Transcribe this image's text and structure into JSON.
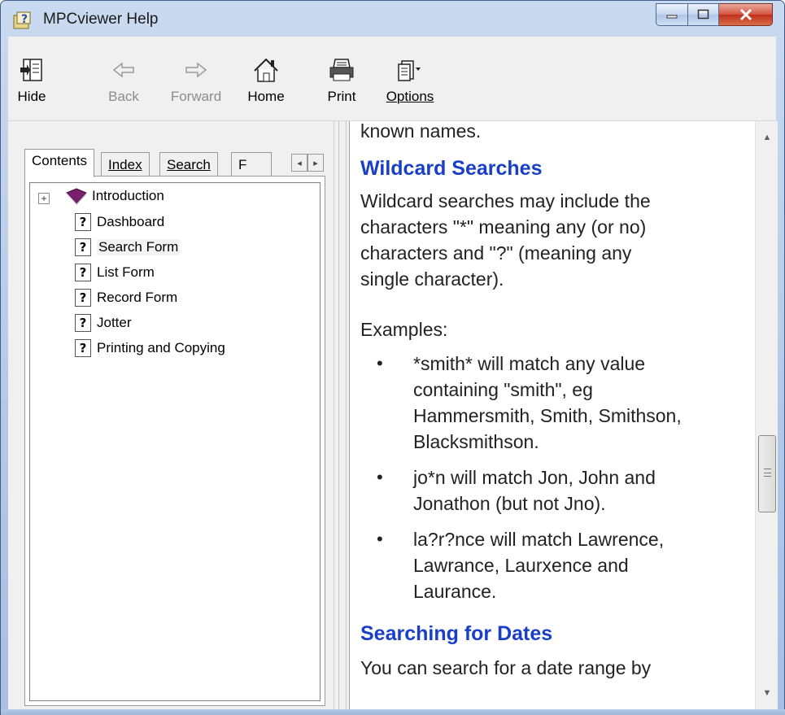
{
  "window": {
    "title": "MPCviewer Help",
    "accent": "#1a3fc7"
  },
  "toolbar": {
    "hide": "Hide",
    "back": "Back",
    "forward": "Forward",
    "home": "Home",
    "print": "Print",
    "options": "Options"
  },
  "tabs": {
    "contents": "Contents",
    "index": "Index",
    "search": "Search",
    "favorites": "F"
  },
  "tree": {
    "items": [
      {
        "label": "Introduction",
        "icon": "book-icon"
      },
      {
        "label": "Dashboard",
        "icon": "help-page-icon"
      },
      {
        "label": "Search Form",
        "icon": "help-page-icon"
      },
      {
        "label": "List Form",
        "icon": "help-page-icon"
      },
      {
        "label": "Record Form",
        "icon": "help-page-icon"
      },
      {
        "label": "Jotter",
        "icon": "help-page-icon"
      },
      {
        "label": "Printing and Copying",
        "icon": "help-page-icon"
      }
    ]
  },
  "content": {
    "prev_text": "known names.",
    "heading1": "Wildcard Searches",
    "para1_l1": "Wildcard searches may include the",
    "para1_l2": "characters \"*\" meaning any (or no)",
    "para1_l3": "characters and \"?\" (meaning any",
    "para1_l4": "single character).",
    "examples_label": "Examples:",
    "bullets": [
      {
        "l1": "*smith* will match any value",
        "l2": "containing \"smith\", eg",
        "l3": "Hammersmith, Smith, Smithson,",
        "l4": "Blacksmithson."
      },
      {
        "l1": "jo*n will match Jon, John and",
        "l2": "Jonathon (but not Jno)."
      },
      {
        "l1": "la?r?nce will match Lawrence,",
        "l2": "Lawrance, Laurxence and",
        "l3": "Laurance."
      }
    ],
    "heading2": "Searching for Dates",
    "para2_l1": "You can search for a date range by"
  }
}
